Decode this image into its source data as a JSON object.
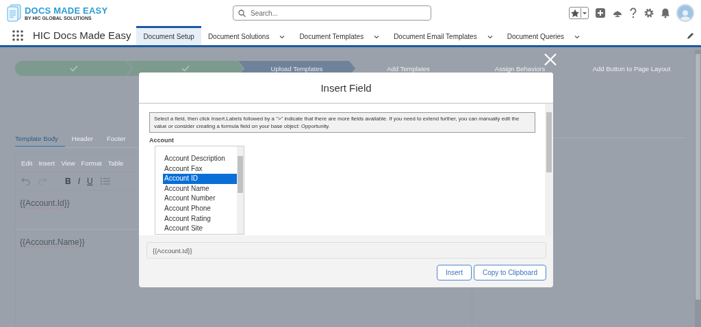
{
  "header": {
    "logo": {
      "title": "DOCS MADE EASY",
      "subtitle": "BY HIC GLOBAL SOLUTIONS"
    },
    "search": {
      "placeholder": "Search..."
    }
  },
  "nav": {
    "app_name": "HIC Docs Made Easy",
    "tabs": [
      {
        "label": "Document Setup",
        "selected": true,
        "has_menu": false
      },
      {
        "label": "Document Solutions",
        "selected": false,
        "has_menu": true
      },
      {
        "label": "Document Templates",
        "selected": false,
        "has_menu": true
      },
      {
        "label": "Document Email Templates",
        "selected": false,
        "has_menu": true
      },
      {
        "label": "Document Queries",
        "selected": false,
        "has_menu": true
      }
    ]
  },
  "stepper": {
    "steps": [
      {
        "complete": true,
        "current": false
      },
      {
        "complete": true,
        "current": false
      },
      {
        "complete": false,
        "current": true,
        "label": "Upload Templates"
      },
      {
        "complete": false,
        "current": false,
        "label": "Add Templates"
      },
      {
        "complete": false,
        "current": false,
        "label": "Assign Behaviors"
      },
      {
        "complete": false,
        "current": false,
        "label": "Add Button to Page Layout"
      }
    ]
  },
  "editor": {
    "tabs": [
      {
        "label": "Template Body",
        "selected": true
      },
      {
        "label": "Header",
        "selected": false
      },
      {
        "label": "Footer",
        "selected": false
      }
    ],
    "menu": [
      "Edit",
      "Insert",
      "View",
      "Format",
      "Table"
    ],
    "format_buttons": [
      {
        "kind": "bold",
        "label": "B"
      },
      {
        "kind": "italic",
        "label": "I"
      },
      {
        "kind": "underline",
        "label": "U"
      }
    ],
    "lines": [
      "{{Account.Id}}",
      "{{Account.Name}}"
    ]
  },
  "modal": {
    "title": "Insert Field",
    "info": "Select a field, then click Insert.Labels followed by a \">\" indicate that there are more fields available. If you need to extend further, you can manually edit the value or consider creating a formula field on your base object: Opportunity.",
    "group_label": "Account",
    "fields": [
      {
        "label": "Account Description",
        "selected": false
      },
      {
        "label": "Account Fax",
        "selected": false
      },
      {
        "label": "Account ID",
        "selected": true
      },
      {
        "label": "Account Name",
        "selected": false
      },
      {
        "label": "Account Number",
        "selected": false
      },
      {
        "label": "Account Phone",
        "selected": false
      },
      {
        "label": "Account Rating",
        "selected": false
      },
      {
        "label": "Account Site",
        "selected": false
      }
    ],
    "value": "{{Account.Id}}",
    "buttons": [
      "Insert",
      "Copy to Clipboard"
    ]
  }
}
